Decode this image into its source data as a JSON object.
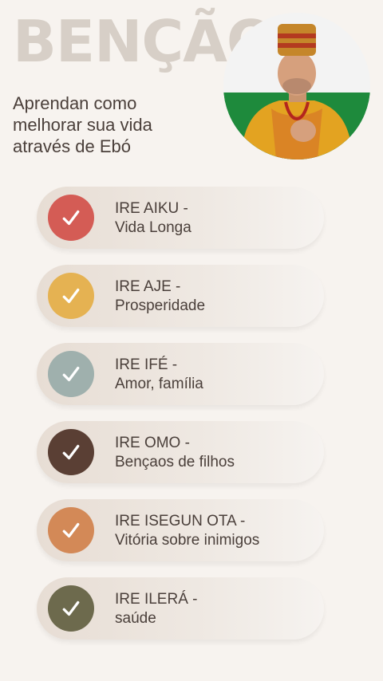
{
  "header": {
    "title": "BENÇÃOS",
    "subtitle": "Aprendan como melhorar sua vida através de Ebó"
  },
  "items": [
    {
      "label": "IRE AIKU -",
      "desc": "Vida Longa",
      "color": "#d45c55"
    },
    {
      "label": "IRE AJE -",
      "desc": "Prosperidade",
      "color": "#e5b252"
    },
    {
      "label": "IRE IFÉ -",
      "desc": "Amor, família",
      "color": "#9fb0ad"
    },
    {
      "label": "IRE OMO -",
      "desc": "Bençaos de filhos",
      "color": "#5a3f34"
    },
    {
      "label": "IRE ISEGUN OTA -",
      "desc": "Vitória sobre inimigos",
      "color": "#d38957"
    },
    {
      "label": "IRE ILERÁ -",
      "desc": "saúde",
      "color": "#6d6a4d"
    }
  ]
}
